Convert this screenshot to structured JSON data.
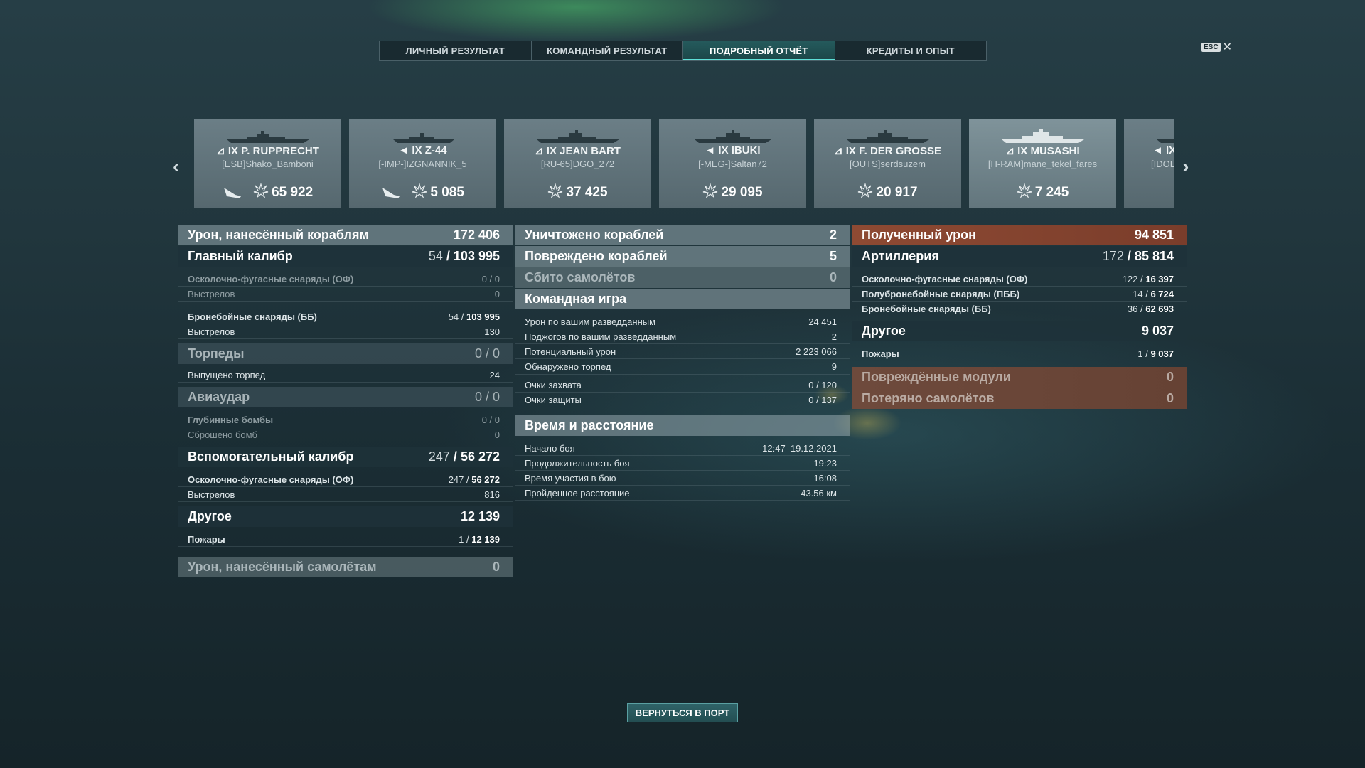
{
  "tabs": [
    {
      "label": "ЛИЧНЫЙ РЕЗУЛЬТАТ"
    },
    {
      "label": "КОМАНДНЫЙ РЕЗУЛЬТАТ"
    },
    {
      "label": "ПОДРОБНЫЙ ОТЧЁТ",
      "active": true
    },
    {
      "label": "КРЕДИТЫ И ОПЫТ"
    }
  ],
  "esc": {
    "key": "ESC",
    "close": "✕"
  },
  "ships": [
    {
      "name": "IX P. RUPPRECHT",
      "player": "[ESB]Shako_Bamboni",
      "damage": "65 922",
      "plane": true
    },
    {
      "name": "IX Z-44",
      "player": "[-IMP-]IZGNANNIK_5",
      "damage": "5 085",
      "plane": true
    },
    {
      "name": "IX JEAN BART",
      "player": "[RU-65]DGO_272",
      "damage": "37 425"
    },
    {
      "name": "IX IBUKI",
      "player": "[-MEG-]Saltan72",
      "damage": "29 095"
    },
    {
      "name": "IX F. DER GROSSE",
      "player": "[OUTS]serdsuzem",
      "damage": "20 917"
    },
    {
      "name": "IX MUSASHI",
      "player": "[H-RAM]mane_tekel_fares",
      "damage": "7 245",
      "active": true
    },
    {
      "name": "IX",
      "player": "[IDOL",
      "damage": ""
    }
  ],
  "left": {
    "dealt": {
      "label": "Урон, нанесённый кораблям",
      "value": "172 406"
    },
    "main": {
      "label": "Главный калибр",
      "hits": "54",
      "value": "103 995"
    },
    "he": {
      "label": "Осколочно-фугасные снаряды (ОФ)",
      "value": "0 / 0"
    },
    "he_shots": {
      "label": "Выстрелов",
      "value": "0"
    },
    "ap": {
      "label": "Бронебойные снаряды (ББ)",
      "hits": "54",
      "value": "103 995"
    },
    "ap_shots": {
      "label": "Выстрелов",
      "value": "130"
    },
    "torp": {
      "label": "Торпеды",
      "value": "0 / 0"
    },
    "torp_fired": {
      "label": "Выпущено торпед",
      "value": "24"
    },
    "air": {
      "label": "Авиаудар",
      "value": "0 / 0"
    },
    "depth": {
      "label": "Глубинные бомбы",
      "value": "0 / 0"
    },
    "bombs": {
      "label": "Сброшено бомб",
      "value": "0"
    },
    "sec": {
      "label": "Вспомогательный калибр",
      "hits": "247",
      "value": "56 272"
    },
    "sec_he": {
      "label": "Осколочно-фугасные снаряды (ОФ)",
      "hits": "247",
      "value": "56 272"
    },
    "sec_shots": {
      "label": "Выстрелов",
      "value": "816"
    },
    "other": {
      "label": "Другое",
      "value": "12 139"
    },
    "fires": {
      "label": "Пожары",
      "hits": "1",
      "value": "12 139"
    },
    "planes": {
      "label": "Урон, нанесённый самолётам",
      "value": "0"
    }
  },
  "mid": {
    "destroyed": {
      "label": "Уничтожено кораблей",
      "value": "2"
    },
    "damaged": {
      "label": "Повреждено кораблей",
      "value": "5"
    },
    "shot_planes": {
      "label": "Сбито самолётов",
      "value": "0"
    },
    "team": {
      "label": "Командная игра"
    },
    "spot_dmg": {
      "label": "Урон по вашим разведданным",
      "value": "24 451"
    },
    "spot_fires": {
      "label": "Поджогов по вашим разведданным",
      "value": "2"
    },
    "potential": {
      "label": "Потенциальный урон",
      "value": "2 223 066"
    },
    "torp_spotted": {
      "label": "Обнаружено торпед",
      "value": "9"
    },
    "capture": {
      "label": "Очки захвата",
      "value": "0 / 120"
    },
    "defense": {
      "label": "Очки защиты",
      "value": "0 / 137"
    },
    "time": {
      "label": "Время и расстояние"
    },
    "start": {
      "label": "Начало боя",
      "value": "12:47  19.12.2021"
    },
    "duration": {
      "label": "Продолжительность боя",
      "value": "19:23"
    },
    "participation": {
      "label": "Время участия в бою",
      "value": "16:08"
    },
    "distance": {
      "label": "Пройденное расстояние",
      "value": "43.56 км"
    }
  },
  "right": {
    "received": {
      "label": "Полученный урон",
      "value": "94 851"
    },
    "artillery": {
      "label": "Артиллерия",
      "hits": "172",
      "value": "85 814"
    },
    "he": {
      "label": "Осколочно-фугасные снаряды (ОФ)",
      "hits": "122",
      "value": "16 397"
    },
    "sap": {
      "label": "Полубронебойные снаряды (ПББ)",
      "hits": "14",
      "value": "6 724"
    },
    "ap": {
      "label": "Бронебойные снаряды (ББ)",
      "hits": "36",
      "value": "62 693"
    },
    "other": {
      "label": "Другое",
      "value": "9 037"
    },
    "fires": {
      "label": "Пожары",
      "hits": "1",
      "value": "9 037"
    },
    "modules": {
      "label": "Повреждённые модули",
      "value": "0"
    },
    "lost_planes": {
      "label": "Потеряно самолётов",
      "value": "0"
    }
  },
  "back_button": "ВЕРНУТЬСЯ В ПОРТ"
}
